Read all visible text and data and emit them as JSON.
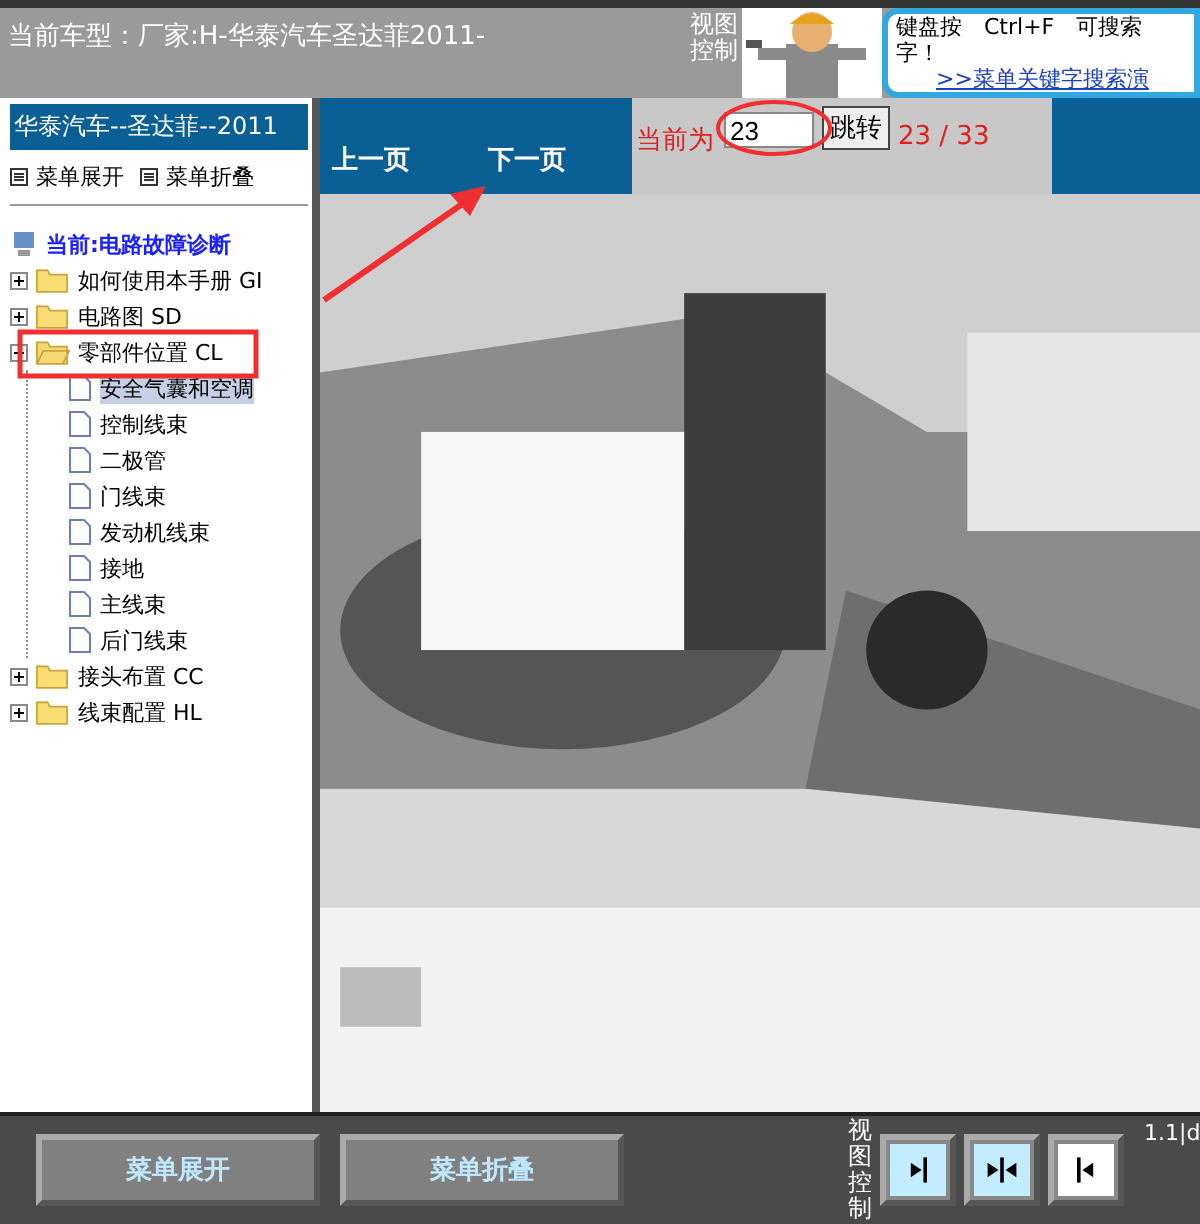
{
  "header": {
    "vehicle": "当前车型：厂家:H-华泰汽车圣达菲2011-",
    "view_control": "视图控制",
    "help_lines": [
      "键盘按　Ctrl+F　可搜索",
      "字！"
    ],
    "help_link": ">>菜单关键字搜索演"
  },
  "sidebar": {
    "title": "华泰汽车--圣达菲--2011",
    "actions": [
      "菜单展开",
      "菜单折叠"
    ],
    "tree": [
      {
        "label": "当前:电路故障诊断",
        "kind": "current"
      },
      {
        "label": "如何使用本手册 GI",
        "kind": "folder",
        "expanded": false
      },
      {
        "label": "电路图 SD",
        "kind": "folder",
        "expanded": false
      },
      {
        "label": "零部件位置 CL",
        "kind": "folder",
        "expanded": true,
        "children": [
          {
            "label": "安全气囊和空调",
            "selected": true
          },
          {
            "label": "控制线束",
            "selected": false
          },
          {
            "label": "二极管",
            "selected": false
          },
          {
            "label": "门线束",
            "selected": false
          },
          {
            "label": "发动机线束",
            "selected": false
          },
          {
            "label": "接地",
            "selected": false
          },
          {
            "label": "主线束",
            "selected": false
          },
          {
            "label": "后门线束",
            "selected": false
          }
        ]
      },
      {
        "label": "接头布置 CC",
        "kind": "folder",
        "expanded": false
      },
      {
        "label": "线束配置 HL",
        "kind": "folder",
        "expanded": false
      }
    ]
  },
  "nav": {
    "prev": "上一页",
    "next": "下一页",
    "current_label": "当前为",
    "page_input": "23",
    "go_button": "跳转",
    "page_count": "23 / 33"
  },
  "bottom": {
    "buttons": [
      "菜单展开",
      "菜单折叠"
    ],
    "view_control": "视图控制",
    "view_buttons": [
      {
        "kind": "right",
        "highlighted": true
      },
      {
        "kind": "center",
        "highlighted": true
      },
      {
        "kind": "left",
        "highlighted": false
      }
    ],
    "status": "1.1|d"
  }
}
